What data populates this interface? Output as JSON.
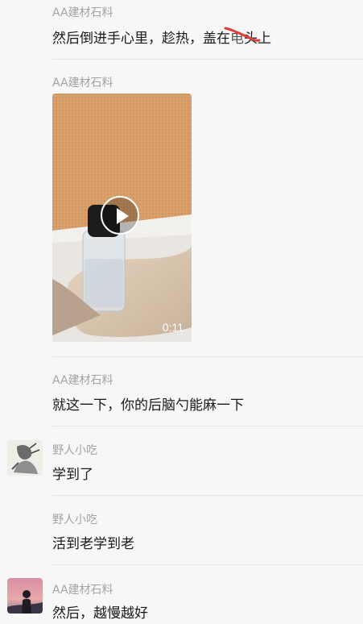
{
  "messages": [
    {
      "sender": "AA建材石料",
      "text_before": "然后倒进手心里，趁热，盖在",
      "text_struck": "电",
      "text_after": "头上"
    },
    {
      "sender": "AA建材石料",
      "video": {
        "duration": "0:11"
      }
    },
    {
      "sender": "AA建材石料",
      "text": "就这一下，你的后脑勺能麻一下"
    },
    {
      "sender": "野人小吃",
      "text": "学到了"
    },
    {
      "sender": "野人小吃",
      "text": "活到老学到老"
    },
    {
      "sender": "AA建材石料",
      "text": "然后，越慢越好"
    }
  ],
  "colors": {
    "background": "#f7f7f7",
    "sender": "#a3a3a3",
    "text": "#1a1a1a",
    "strike": "#e0403a"
  },
  "icons": {
    "play": "play-icon"
  }
}
